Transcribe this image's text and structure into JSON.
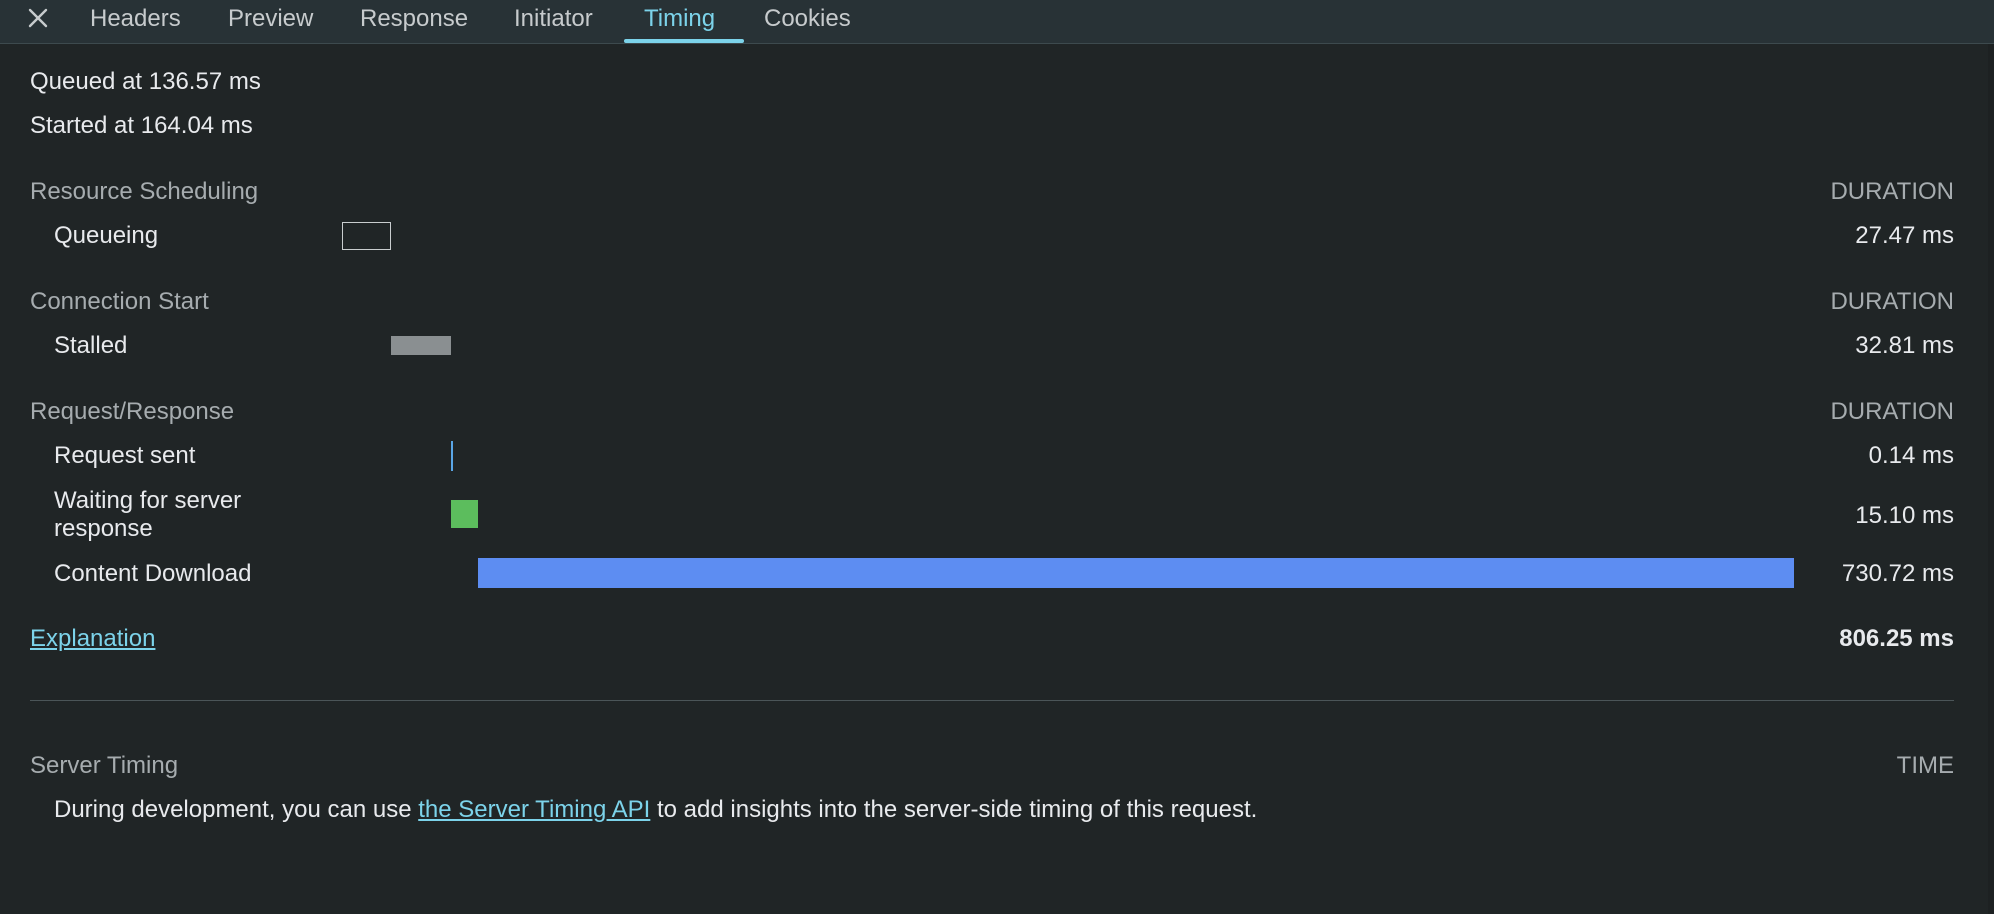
{
  "tabs": {
    "items": [
      {
        "label": "Headers"
      },
      {
        "label": "Preview"
      },
      {
        "label": "Response"
      },
      {
        "label": "Initiator"
      },
      {
        "label": "Timing"
      },
      {
        "label": "Cookies"
      }
    ],
    "active": "Timing"
  },
  "timing": {
    "queued": "Queued at 136.57 ms",
    "started": "Started at 164.04 ms",
    "duration_header": "DURATION",
    "sections": [
      {
        "title": "Resource Scheduling",
        "rows": [
          {
            "label": "Queueing",
            "value": "27.47 ms"
          }
        ]
      },
      {
        "title": "Connection Start",
        "rows": [
          {
            "label": "Stalled",
            "value": "32.81 ms"
          }
        ]
      },
      {
        "title": "Request/Response",
        "rows": [
          {
            "label": "Request sent",
            "value": "0.14 ms"
          },
          {
            "label": "Waiting for server response",
            "value": "15.10 ms"
          },
          {
            "label": "Content Download",
            "value": "730.72 ms"
          }
        ]
      }
    ],
    "explanation_link": "Explanation",
    "total": "806.25 ms"
  },
  "server_timing": {
    "title": "Server Timing",
    "time_header": "TIME",
    "text_before": "During development, you can use ",
    "link": "the Server Timing API",
    "text_after": " to add insights into the server-side timing of this request."
  },
  "colors": {
    "accent": "#7cd3ea",
    "stalled": "#8a8f91",
    "request_sent": "#5aa6e6",
    "waiting": "#5cbd5d",
    "content_download": "#5d8df2",
    "background": "#202526"
  }
}
